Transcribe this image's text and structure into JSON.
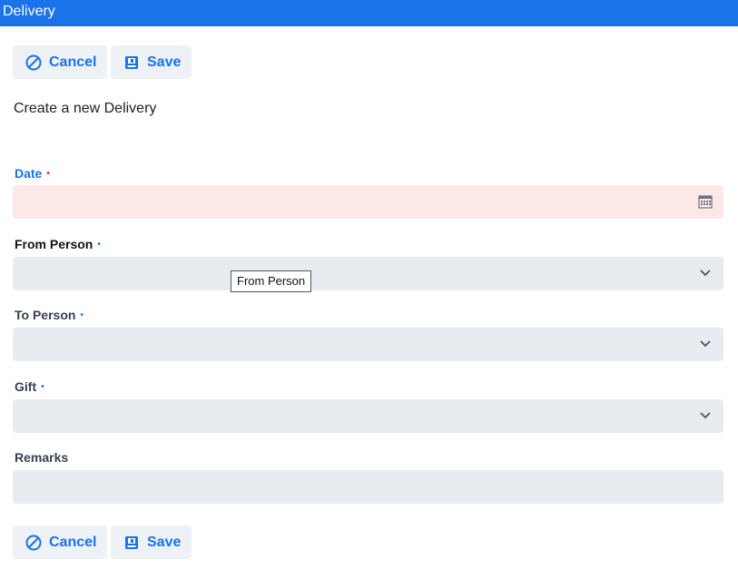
{
  "window": {
    "title": "Delivery"
  },
  "toolbar": {
    "cancel_label": "Cancel",
    "save_label": "Save"
  },
  "page": {
    "heading": "Create a new Delivery"
  },
  "form": {
    "date": {
      "label": "Date",
      "required_marker": "•",
      "value": ""
    },
    "from_person": {
      "label": "From Person",
      "required_marker": "•",
      "value": ""
    },
    "to_person": {
      "label": "To Person",
      "required_marker": "•",
      "value": ""
    },
    "gift": {
      "label": "Gift",
      "required_marker": "•",
      "value": ""
    },
    "remarks": {
      "label": "Remarks",
      "value": ""
    }
  },
  "tooltip": {
    "text": "From Person"
  },
  "icons": {
    "cancel": "cancel-icon",
    "save": "save-icon",
    "calendar": "calendar-icon",
    "dropdown": "chevron-down-icon"
  },
  "colors": {
    "accent": "#1a73e8",
    "error_bg": "#fde8e8",
    "required_dot": "#e11d48"
  }
}
